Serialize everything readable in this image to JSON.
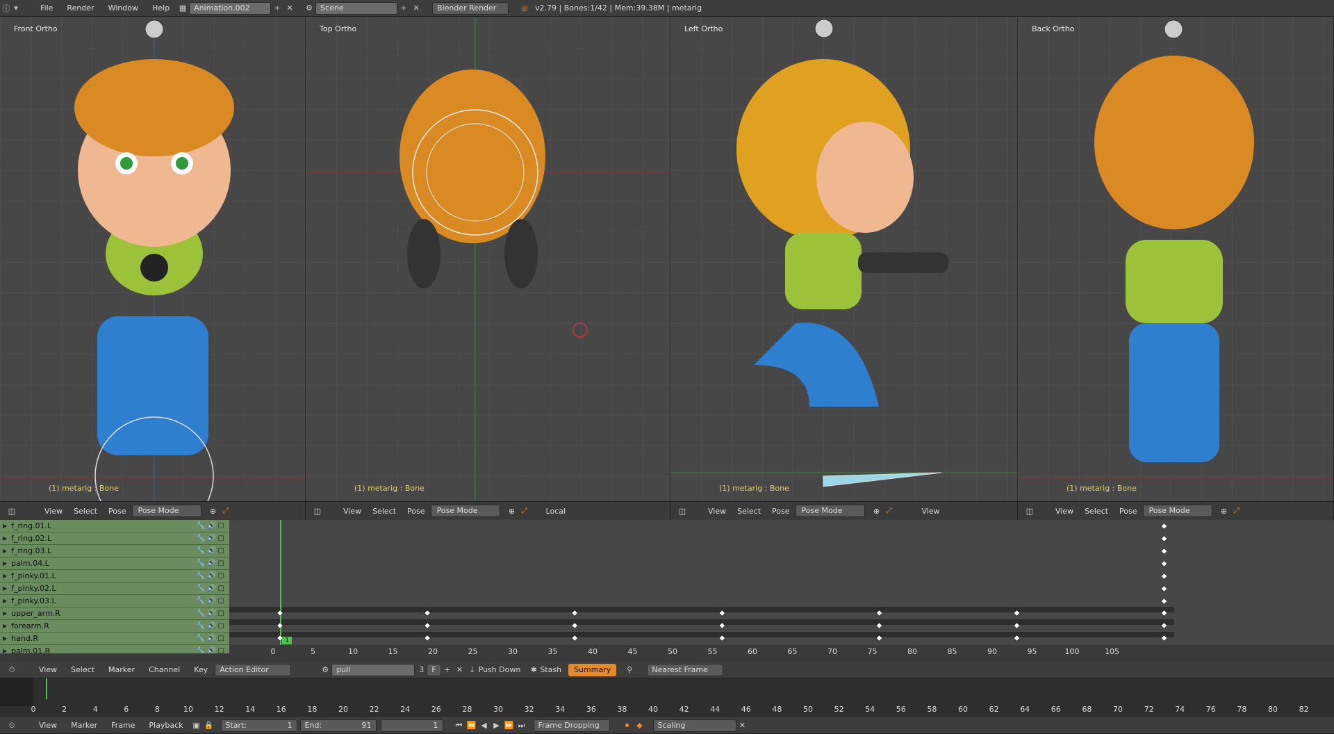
{
  "topbar": {
    "menus": [
      "File",
      "Render",
      "Window",
      "Help"
    ],
    "screen_name": "Animation.002",
    "scene_name": "Scene",
    "engine": "Blender Render",
    "stats": "v2.79 | Bones:1/42 | Mem:39.38M | metarig"
  },
  "viewports": [
    {
      "title": "Front Ortho",
      "status": "(1) metarig : Bone"
    },
    {
      "title": "Top Ortho",
      "status": "(1) metarig : Bone"
    },
    {
      "title": "Left Ortho",
      "status": "(1) metarig : Bone"
    },
    {
      "title": "Back Ortho",
      "status": "(1) metarig : Bone"
    }
  ],
  "vp_headers": [
    {
      "view": "View",
      "select": "Select",
      "pose": "Pose",
      "mode": "Pose Mode"
    },
    {
      "view": "View",
      "select": "Select",
      "pose": "Pose",
      "mode": "Pose Mode",
      "orientation": "Local"
    },
    {
      "view": "View",
      "select": "Select",
      "pose": "Pose",
      "mode": "Pose Mode",
      "extra": "View"
    },
    {
      "view": "View",
      "select": "Select",
      "pose": "Pose",
      "mode": "Pose Mode"
    }
  ],
  "channels": [
    "f_ring.01.L",
    "f_ring.02.L",
    "f_ring.03.L",
    "palm.04.L",
    "f_pinky.01.L",
    "f_pinky.02.L",
    "f_pinky.03.L",
    "upper_arm.R",
    "forearm.R",
    "hand.R",
    "palm.01.R"
  ],
  "dope_ruler": [
    "0",
    "5",
    "10",
    "15",
    "20",
    "25",
    "30",
    "35",
    "40",
    "45",
    "50",
    "55",
    "60",
    "65",
    "70",
    "75",
    "80",
    "85",
    "90",
    "95",
    "100",
    "105"
  ],
  "current_frame_badge": "1",
  "action_header": {
    "view": "View",
    "select": "Select",
    "marker": "Marker",
    "channel": "Channel",
    "key": "Key",
    "editor": "Action Editor",
    "action": "pull",
    "users": "3",
    "fake_user": "F",
    "push_down": "Push Down",
    "stash": "Stash",
    "summary": "Summary",
    "snap": "Nearest Frame"
  },
  "timeline_ruler": [
    "0",
    "2",
    "4",
    "6",
    "8",
    "10",
    "12",
    "14",
    "16",
    "18",
    "20",
    "22",
    "24",
    "26",
    "28",
    "30",
    "32",
    "34",
    "36",
    "38",
    "40",
    "42",
    "44",
    "46",
    "48",
    "50",
    "52",
    "54",
    "56",
    "58",
    "60",
    "62",
    "64",
    "66",
    "68",
    "70",
    "72",
    "74",
    "76",
    "78",
    "80",
    "82"
  ],
  "timeline_header": {
    "view": "View",
    "marker": "Marker",
    "frame": "Frame",
    "playback": "Playback",
    "start_label": "Start:",
    "start": "1",
    "end_label": "End:",
    "end": "91",
    "current": "1",
    "sync": "Frame Dropping",
    "keying_set": "Scaling"
  },
  "colors": {
    "selection": "#e68a2e",
    "keyframe": "#ffffff",
    "channel": "#6b8c5f",
    "playhead": "#4fc24f"
  }
}
